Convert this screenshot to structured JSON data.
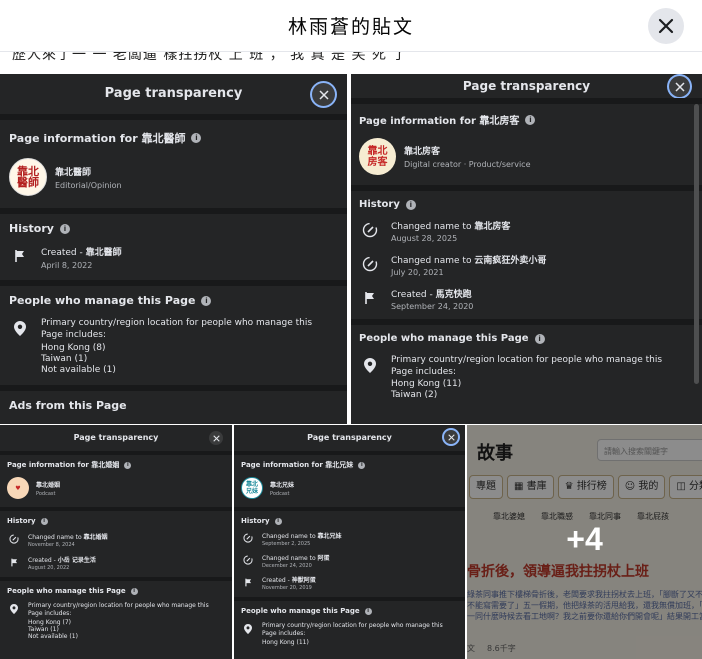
{
  "dialog": {
    "title": "林雨蒼的貼文"
  },
  "strip_text": "歷人來了一 一 老闆逼 樣拄拐杖 上 班 ， 我 真 是 笑 死 了",
  "tiles": [
    {
      "header": "Page transparency",
      "info_title": "Page information for 靠北醫師",
      "page_name": "靠北醫師",
      "category": "Editorial/Opinion",
      "avatar_text": "靠北\n醫師",
      "history_title": "History",
      "history": [
        {
          "icon": "flag-icon",
          "prefix": "Created - ",
          "name": "靠北醫師",
          "date": "April 8, 2022"
        }
      ],
      "manage_title": "People who manage this Page",
      "manage_desc": "Primary country/region location for people who manage this Page includes:",
      "locations": [
        "Hong Kong (8)",
        "Taiwan (1)",
        "Not available (1)"
      ],
      "ads_title": "Ads from this Page"
    },
    {
      "header": "Page transparency",
      "info_title": "Page information for 靠北房客",
      "page_name": "靠北房客",
      "category": "Digital creator · Product/service",
      "avatar_text": "靠北\n房客",
      "history_title": "History",
      "history": [
        {
          "icon": "rename-icon",
          "prefix": "Changed name to ",
          "name": "靠北房客",
          "date": "August 28, 2025"
        },
        {
          "icon": "rename-icon",
          "prefix": "Changed name to ",
          "name": "云南疯狂外卖小哥",
          "date": "July 20, 2021"
        },
        {
          "icon": "flag-icon",
          "prefix": "Created - ",
          "name": "馬克快跑",
          "date": "September 24, 2020"
        }
      ],
      "manage_title": "People who manage this Page",
      "manage_desc": "Primary country/region location for people who manage this Page includes:",
      "locations": [
        "Hong Kong (11)",
        "Taiwan (2)"
      ]
    },
    {
      "header": "Page transparency",
      "info_title": "Page information for 靠北婚姻",
      "page_name": "靠北婚姻",
      "category": "Podcast",
      "history_title": "History",
      "history": [
        {
          "icon": "rename-icon",
          "prefix": "Changed name to ",
          "name": "靠北婚姻",
          "date": "November 8, 2024"
        },
        {
          "icon": "flag-icon",
          "prefix": "Created - ",
          "name": "小岳 记录生活",
          "date": "August 20, 2022"
        }
      ],
      "manage_title": "People who manage this Page",
      "manage_desc": "Primary country/region location for people who manage this Page includes:",
      "locations": [
        "Hong Kong (7)",
        "Taiwan (1)",
        "Not available (1)"
      ]
    },
    {
      "header": "Page transparency",
      "info_title": "Page information for 靠北兄妹",
      "page_name": "靠北兄妹",
      "category": "Podcast",
      "avatar_text": "靠北\n兄妹",
      "history_title": "History",
      "history": [
        {
          "icon": "rename-icon",
          "prefix": "Changed name to ",
          "name": "靠北兄妹",
          "date": "September 2, 2025"
        },
        {
          "icon": "rename-icon",
          "prefix": "Changed name to ",
          "name": "阿蛋",
          "date": "December 24, 2020"
        },
        {
          "icon": "flag-icon",
          "prefix": "Created - ",
          "name": "神獸阿蛋",
          "date": "November 20, 2019"
        }
      ],
      "manage_title": "People who manage this Page",
      "manage_desc": "Primary country/region location for people who manage this Page includes:",
      "locations": [
        "Hong Kong (11)"
      ]
    }
  ],
  "web": {
    "logo_suffix": "故事",
    "search_placeholder": "請輸入搜索關鍵字",
    "nav": [
      "專題",
      "書庫",
      "排行榜",
      "我的",
      "分類"
    ],
    "subnav": [
      "靠北婆媳",
      "靠北職感",
      "靠北同事",
      "靠北屁孩"
    ],
    "headline": "骨折後，領導逼我拄拐杖上班",
    "body1": "綠茶同事推下樓梯骨折後，老闆要求我拄拐杖去上班，「腳斷了又不是",
    "body2": "不能寫需要了」五一假期，他把綠茶的活甩給我，還我無償加班，「",
    "body3": "一同什麼時候去看工地啊？我之前要你還給你們開會呢」結果開工當天",
    "author_hint": "文",
    "words": "8.6千字",
    "more_count": "+4"
  },
  "colors": {
    "fb_dark": "#242526",
    "fb_sep": "#18191a",
    "text_primary": "#e4e6eb",
    "text_secondary": "#b0b3b8"
  }
}
